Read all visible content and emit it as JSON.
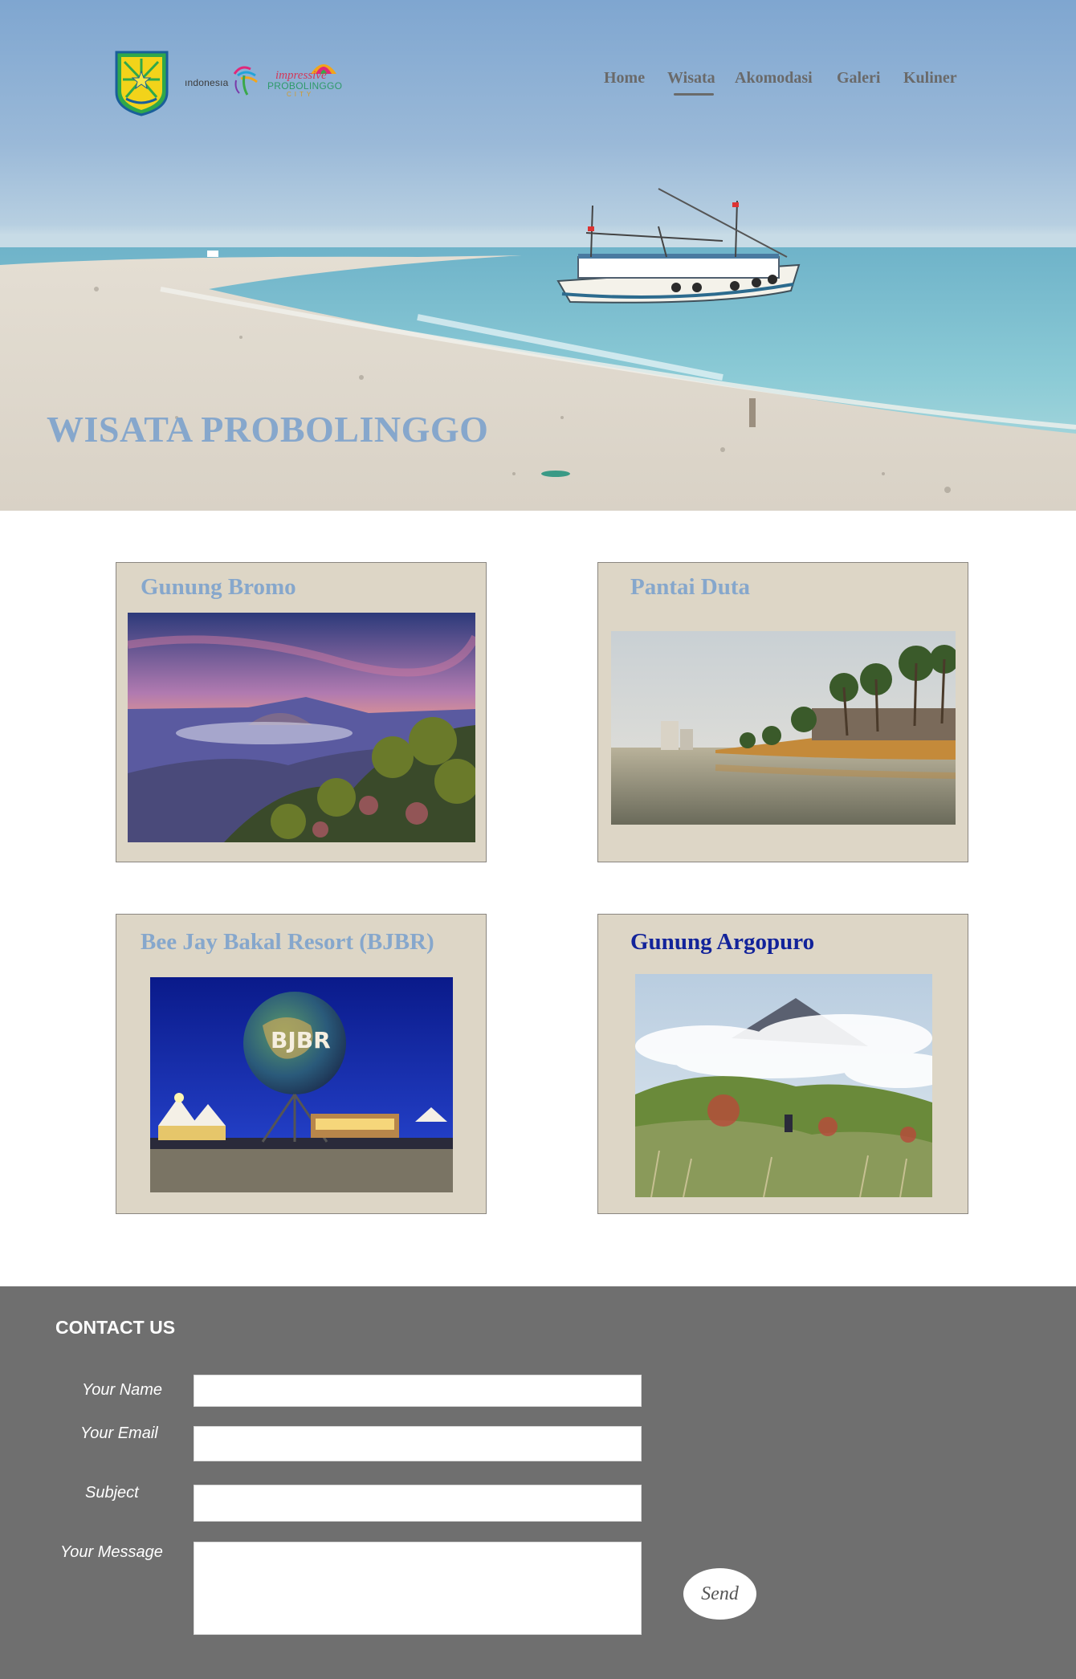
{
  "header": {
    "logos": {
      "emblem": "probolinggo-emblem-icon",
      "indonesia_word": "ındonesıa",
      "impressive_line1": "impressive",
      "impressive_line2": "PROBOLINGGO",
      "impressive_line3": "CITY"
    },
    "nav": [
      {
        "label": "Home",
        "active": false
      },
      {
        "label": "Wisata",
        "active": true
      },
      {
        "label": "Akomodasi",
        "active": false
      },
      {
        "label": "Galeri",
        "active": false
      },
      {
        "label": "Kuliner",
        "active": false
      }
    ]
  },
  "hero": {
    "title": "WISATA PROBOLINGGO",
    "image": "beach-with-fishing-boat"
  },
  "destinations": [
    {
      "title": "Gunung Bromo",
      "image": "mount-bromo-sunrise"
    },
    {
      "title": "Pantai Duta",
      "image": "pantai-duta-palm-shore"
    },
    {
      "title": "Bee Jay Bakal Resort (BJBR)",
      "image": "bjbr-globe-night",
      "globe_text": "BJBR"
    },
    {
      "title": "Gunung Argopuro",
      "image": "mount-argopuro-hike"
    }
  ],
  "contact": {
    "heading": "CONTACT US",
    "name_label": "Your Name",
    "email_label": "Your Email",
    "subject_label": "Subject",
    "message_label": "Your Message",
    "name_value": "",
    "email_value": "",
    "subject_value": "",
    "message_value": "",
    "send_label": "Send"
  },
  "colors": {
    "title_blue": "#86a7cc",
    "argopuro_title": "#12239a",
    "card_bg": "#ddd6c6",
    "footer_bg": "#6f6f6f",
    "nav_text": "#6a6a6a"
  }
}
